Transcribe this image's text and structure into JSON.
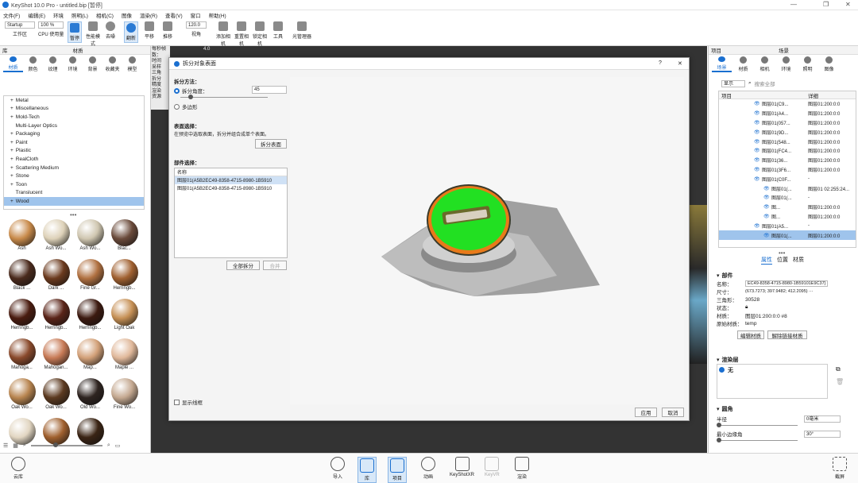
{
  "window": {
    "title": "KeyShot 10.0 Pro  - untitled.bip [暂停]"
  },
  "menu": [
    "文件(F)",
    "编辑(E)",
    "环境",
    "照明(L)",
    "相机(C)",
    "图像",
    "渲染(R)",
    "查看(V)",
    "窗口",
    "帮助(H)"
  ],
  "toolbar": {
    "workspace_select": "Startup",
    "workspace_label": "工作区",
    "cpu_percent": "100 %",
    "cpu_label": "CPU 使用量",
    "pause": "暂停",
    "perf_mode": "性能模式",
    "denoise": "去噪",
    "refresh": "翻新",
    "pan": "平移",
    "dolly": "推移",
    "angle_value": "120.0",
    "angle_label": "视角",
    "add_camera": "添加相机",
    "reset_camera": "重置相机",
    "lock_camera": "锁定相机",
    "tools": "工具",
    "light_manager": "光管理器"
  },
  "left": {
    "library_title": "库",
    "materials_title": "材质",
    "tabs": [
      "材质",
      "颜色",
      "纹理",
      "环境",
      "背景",
      "收藏夹",
      "模型"
    ],
    "tree": [
      "Metal",
      "Miscellaneous",
      "Mold-Tech",
      "Multi-Layer Optics",
      "Packaging",
      "Paint",
      "Plastic",
      "RealCloth",
      "Scattering Medium",
      "Stone",
      "Toon",
      "Translucent",
      "Wood"
    ],
    "selected_tree": "Wood",
    "thumbs": [
      {
        "label": "Ash",
        "color": "#c88a4a"
      },
      {
        "label": "Ash Wo...",
        "color": "#ddd1b8"
      },
      {
        "label": "Ash Wo...",
        "color": "#cfc6b0"
      },
      {
        "label": "Blac...",
        "color": "#6a4a3a"
      },
      {
        "label": "Black ...",
        "color": "#4a2a1c"
      },
      {
        "label": "Dark ...",
        "color": "#6b3a1e"
      },
      {
        "label": "Fine Gr...",
        "color": "#b07040"
      },
      {
        "label": "Herringb...",
        "color": "#a06030"
      },
      {
        "label": "Herringb...",
        "color": "#4a1c10"
      },
      {
        "label": "Herringb...",
        "color": "#5a2418"
      },
      {
        "label": "Herringb...",
        "color": "#3c1a10"
      },
      {
        "label": "Light Oak",
        "color": "#c69055"
      },
      {
        "label": "Mahoga...",
        "color": "#8a4a2c"
      },
      {
        "label": "Mahogan...",
        "color": "#c77a56"
      },
      {
        "label": "Map...",
        "color": "#d2a078"
      },
      {
        "label": "Maple ...",
        "color": "#e0b89a"
      },
      {
        "label": "Oak Wo...",
        "color": "#b88550"
      },
      {
        "label": "Oak Wo...",
        "color": "#5c3a20"
      },
      {
        "label": "Old Wo...",
        "color": "#2e2420"
      },
      {
        "label": "Fine Wo...",
        "color": "#c4a890"
      },
      {
        "label": "",
        "color": "#e2d6c2"
      },
      {
        "label": "",
        "color": "#a0602e"
      },
      {
        "label": "",
        "color": "#3a2414"
      }
    ]
  },
  "dialog": {
    "title": "拆分对象表面",
    "help": "?",
    "close": "✕",
    "split_method": "拆分方法：",
    "split_angle": "拆分角度：",
    "angle_value": "45",
    "polygon": "多边形",
    "surface_select": "表面选择：",
    "surface_hint": "在预览中选取表面，拆分并组合成单个表面。",
    "split_surface_btn": "拆分表面",
    "part_select": "部件选择：",
    "list_header": "名称",
    "parts": [
      "图层01(A5B2EC49-8358-4715-8980-1B5910",
      "图层01(A5B2EC49-8358-4715-8980-1B5910"
    ],
    "split_all": "全部拆分",
    "merge": "合并",
    "show_wireframe": "显示线框",
    "apply": "应用",
    "cancel": "取消"
  },
  "viewport_overlay": [
    "每秒帧数：",
    "4.0",
    "时间",
    "采样",
    "三角",
    "拆分",
    "精度",
    "渲染",
    "资源"
  ],
  "right": {
    "project_title": "项目",
    "scene_title": "场景",
    "tabs": [
      "场景",
      "材质",
      "相机",
      "环境",
      "照明",
      "图像"
    ],
    "show_select": "显示",
    "search_placeholder": "搜索全部",
    "col_item": "项目",
    "col_detail": "详细",
    "rows": [
      {
        "name": "图层01(C9...",
        "detail": "图层01:200:0:0"
      },
      {
        "name": "图层01(A4...",
        "detail": "图层01:200:0:0"
      },
      {
        "name": "图层01(057...",
        "detail": "图层01:200:0:0"
      },
      {
        "name": "图层01(9D...",
        "detail": "图层01:200:0:0"
      },
      {
        "name": "图层01(548...",
        "detail": "图层01:200:0:0"
      },
      {
        "name": "图层01(FC4...",
        "detail": "图层01:200:0:0"
      },
      {
        "name": "图层01(36...",
        "detail": "图层01:200:0:0"
      },
      {
        "name": "图层01(3F6...",
        "detail": "图层01:200:0:0"
      },
      {
        "name": "图层01(C0F...",
        "detail": "-"
      },
      {
        "name": "图层01(...",
        "detail": "图层01 02:255:24..."
      },
      {
        "name": "图层01(...",
        "detail": "-"
      },
      {
        "name": "图...",
        "detail": "图层01:200:0:0"
      },
      {
        "name": "图...",
        "detail": "图层01:200:0:0"
      },
      {
        "name": "图层01(A5...",
        "detail": "-"
      },
      {
        "name": "图层01(...",
        "detail": "图层01:200:0:0"
      }
    ],
    "sub_tabs": [
      "属性",
      "位置",
      "材质"
    ],
    "part_section": "部件",
    "props": [
      {
        "k": "名称：",
        "v": "EC49-8358-4715-8980-1B59101E9C37}"
      },
      {
        "k": "尺寸：",
        "v": "(673.7273; 397.9482; 412.2095) ⋯"
      },
      {
        "k": "三角形：",
        "v": "30528"
      },
      {
        "k": "状态：",
        "v": ""
      },
      {
        "k": "材质：",
        "v": "图层01:200:0:0 #8"
      },
      {
        "k": "原始材质：",
        "v": "temp"
      }
    ],
    "edit_material": "编辑材质",
    "unlink_material": "解除链接材质",
    "render_layer_section": "渲染层",
    "render_layer_none": "无",
    "round_section": "圆角",
    "radius_label": "半径",
    "radius_value": "0毫米",
    "min_edge_label": "最小边缘角",
    "min_edge_value": "30°"
  },
  "bottom": {
    "cloud": "云库",
    "import": "导入",
    "library": "库",
    "project": "项目",
    "animation": "动画",
    "keyshotxr": "KeyShotXR",
    "keyvr": "KeyVR",
    "render": "渲染",
    "screenshot": "截屏"
  }
}
